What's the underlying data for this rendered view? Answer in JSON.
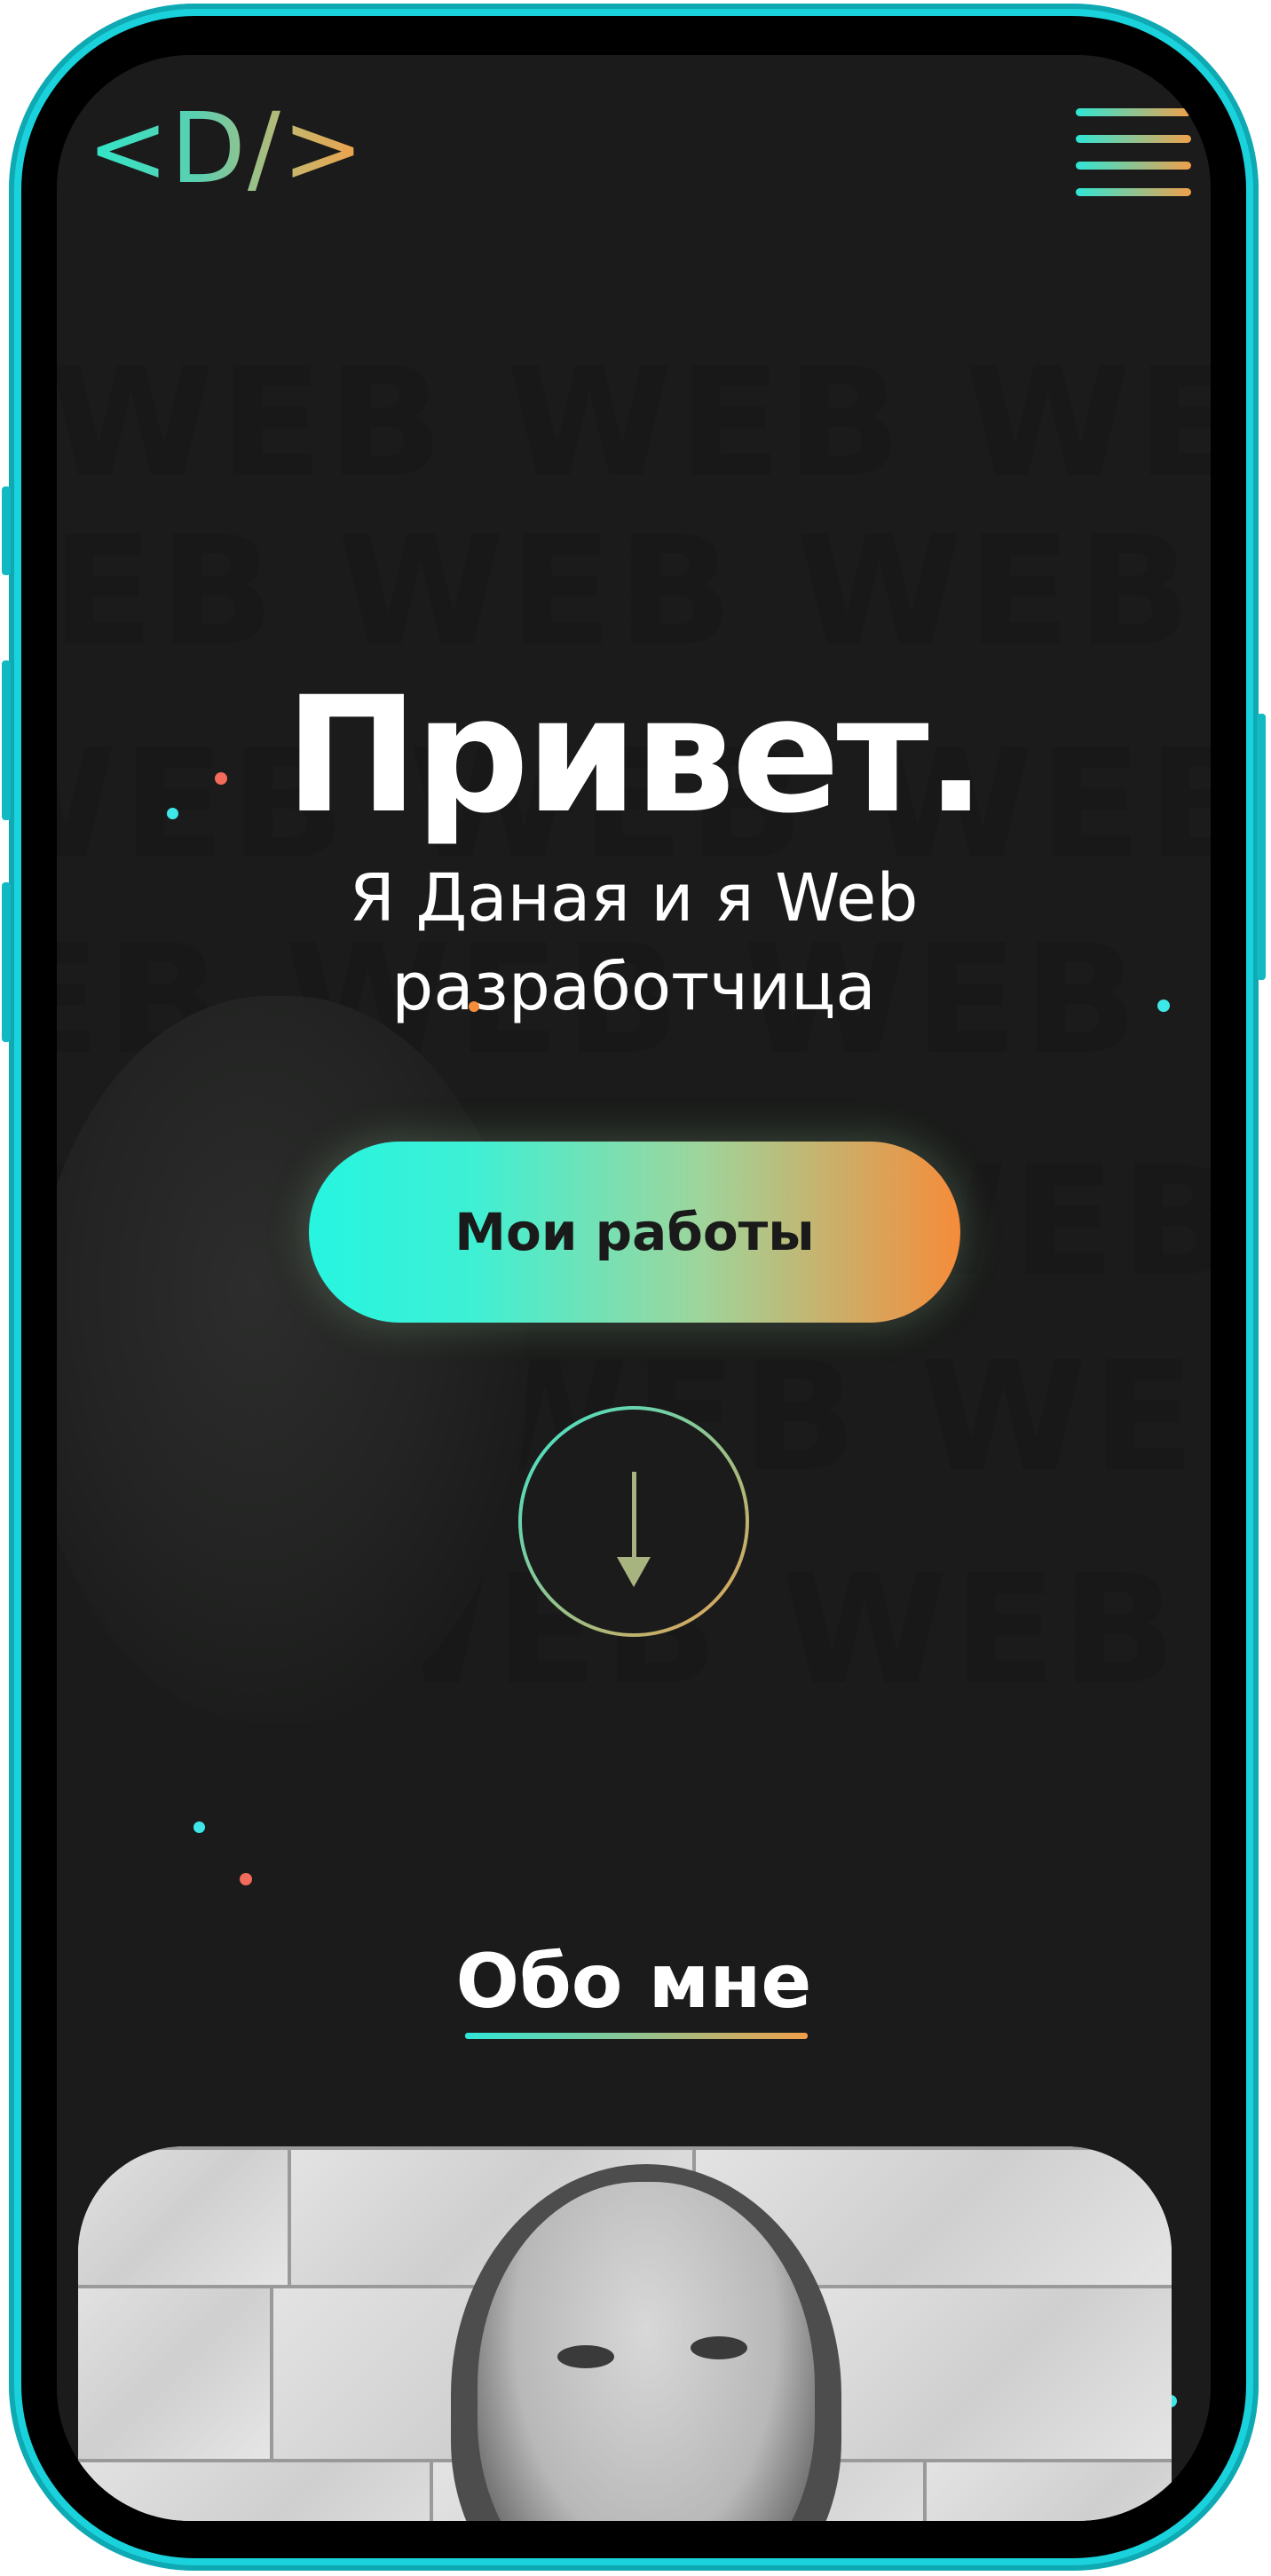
{
  "header": {
    "logo_text": "<D/>",
    "menu_icon": "hamburger-menu-icon"
  },
  "hero": {
    "watermark_word": "WEB WEB WEB",
    "greeting": "Привет.",
    "subtitle_line1": "Я Даная и я Web",
    "subtitle_line2": "разработчица",
    "cta_label": "Мои работы",
    "scroll_icon": "arrow-down-icon"
  },
  "about": {
    "title": "Обо мне"
  },
  "colors": {
    "accent_cyan": "#2fe6d6",
    "accent_orange": "#f58c3a",
    "background": "#1a1b1a",
    "phone_frame": "#1ad2dc"
  }
}
